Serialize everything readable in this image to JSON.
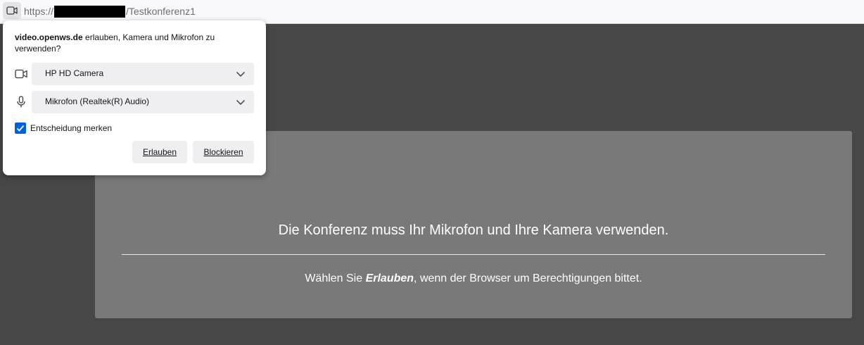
{
  "urlbar": {
    "protocol": "https://",
    "path": "/Testkonferenz1",
    "perm_icon": "camera-icon"
  },
  "permission_popup": {
    "message_host": "video.openws.de",
    "message_text": " erlauben, Kamera und Mikrofon zu verwenden?",
    "camera": {
      "icon": "camera-icon",
      "selected": "HP HD Camera"
    },
    "microphone": {
      "icon": "microphone-icon",
      "selected": "Mikrofon (Realtek(R) Audio)"
    },
    "remember": {
      "label": "Entscheidung merken",
      "checked": true
    },
    "allow_label": "Erlauben",
    "block_label": "Blockieren"
  },
  "notice": {
    "title": "Die Konferenz muss Ihr Mikrofon und Ihre Kamera verwenden.",
    "sub_before": "Wählen Sie ",
    "sub_emph": "Erlauben",
    "sub_after": ", wenn der Browser um Berechtigungen bittet."
  },
  "colors": {
    "page_background": "#474747",
    "notice_background": "#797979",
    "checkbox_accent": "#0061e0"
  }
}
